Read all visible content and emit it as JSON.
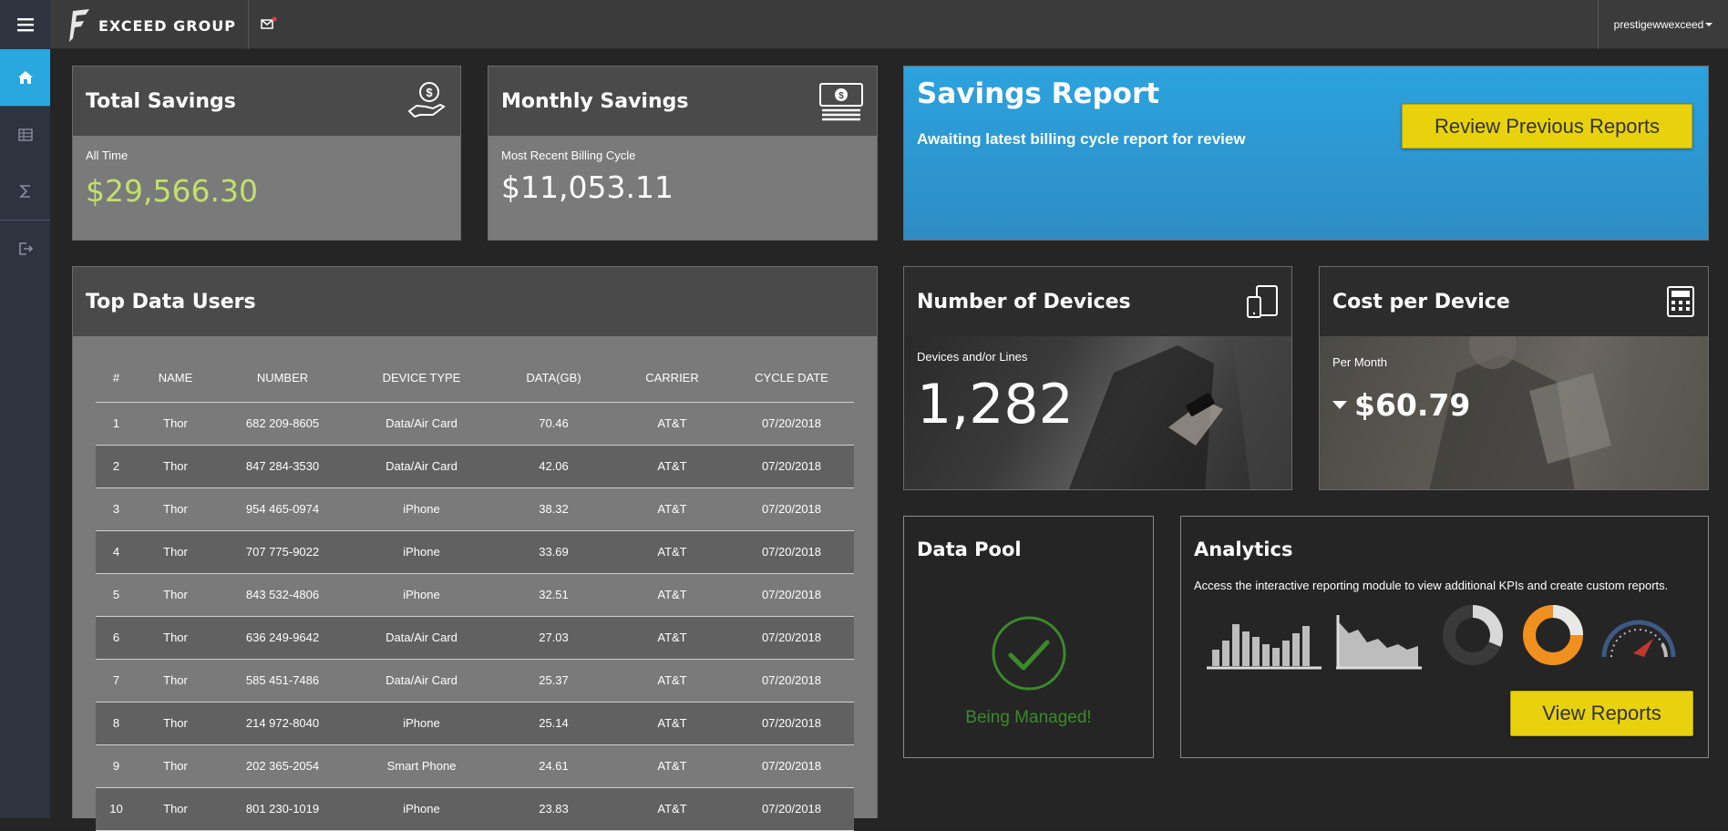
{
  "topbar": {
    "brand": "EXCEED GROUP",
    "username": "prestigewwexceed"
  },
  "sidebar": {
    "items": [
      {
        "name": "home",
        "icon": "home-icon",
        "active": true
      },
      {
        "name": "table",
        "icon": "table-icon",
        "active": false
      },
      {
        "name": "sigma",
        "icon": "sigma-icon",
        "active": false
      },
      {
        "name": "logout",
        "icon": "logout-icon",
        "active": false
      }
    ]
  },
  "total_savings": {
    "title": "Total Savings",
    "label": "All Time",
    "value": "$29,566.30",
    "value_color": "#c3e06c"
  },
  "monthly_savings": {
    "title": "Monthly Savings",
    "label": "Most Recent Billing Cycle",
    "value": "$11,053.11"
  },
  "savings_report": {
    "title": "Savings Report",
    "subtitle": "Awaiting latest billing cycle report for review",
    "button": "Review Previous Reports"
  },
  "top_users": {
    "title": "Top Data Users",
    "columns": [
      "#",
      "NAME",
      "NUMBER",
      "DEVICE TYPE",
      "DATA(GB)",
      "CARRIER",
      "CYCLE DATE"
    ],
    "rows": [
      [
        "1",
        "Thor",
        "682 209-8605",
        "Data/Air Card",
        "70.46",
        "AT&T",
        "07/20/2018"
      ],
      [
        "2",
        "Thor",
        "847 284-3530",
        "Data/Air Card",
        "42.06",
        "AT&T",
        "07/20/2018"
      ],
      [
        "3",
        "Thor",
        "954 465-0974",
        "iPhone",
        "38.32",
        "AT&T",
        "07/20/2018"
      ],
      [
        "4",
        "Thor",
        "707 775-9022",
        "iPhone",
        "33.69",
        "AT&T",
        "07/20/2018"
      ],
      [
        "5",
        "Thor",
        "843 532-4806",
        "iPhone",
        "32.51",
        "AT&T",
        "07/20/2018"
      ],
      [
        "6",
        "Thor",
        "636 249-9642",
        "Data/Air Card",
        "27.03",
        "AT&T",
        "07/20/2018"
      ],
      [
        "7",
        "Thor",
        "585 451-7486",
        "Data/Air Card",
        "25.37",
        "AT&T",
        "07/20/2018"
      ],
      [
        "8",
        "Thor",
        "214 972-8040",
        "iPhone",
        "25.14",
        "AT&T",
        "07/20/2018"
      ],
      [
        "9",
        "Thor",
        "202 365-2054",
        "Smart Phone",
        "24.61",
        "AT&T",
        "07/20/2018"
      ],
      [
        "10",
        "Thor",
        "801 230-1019",
        "iPhone",
        "23.83",
        "AT&T",
        "07/20/2018"
      ]
    ]
  },
  "devices": {
    "title": "Number of Devices",
    "label": "Devices and/or Lines",
    "value": "1,282"
  },
  "cost_per_device": {
    "title": "Cost per Device",
    "label": "Per Month",
    "value": "$60.79"
  },
  "data_pool": {
    "title": "Data Pool",
    "status": "Being Managed!",
    "status_color": "#3a8a2a"
  },
  "analytics": {
    "title": "Analytics",
    "description": "Access the interactive reporting module to view additional KPIs and create custom reports.",
    "button": "View Reports"
  },
  "colors": {
    "accent_blue": "#29a8e0",
    "yellow_button": "#e8d20e",
    "orange_donut": "#f0901e"
  }
}
